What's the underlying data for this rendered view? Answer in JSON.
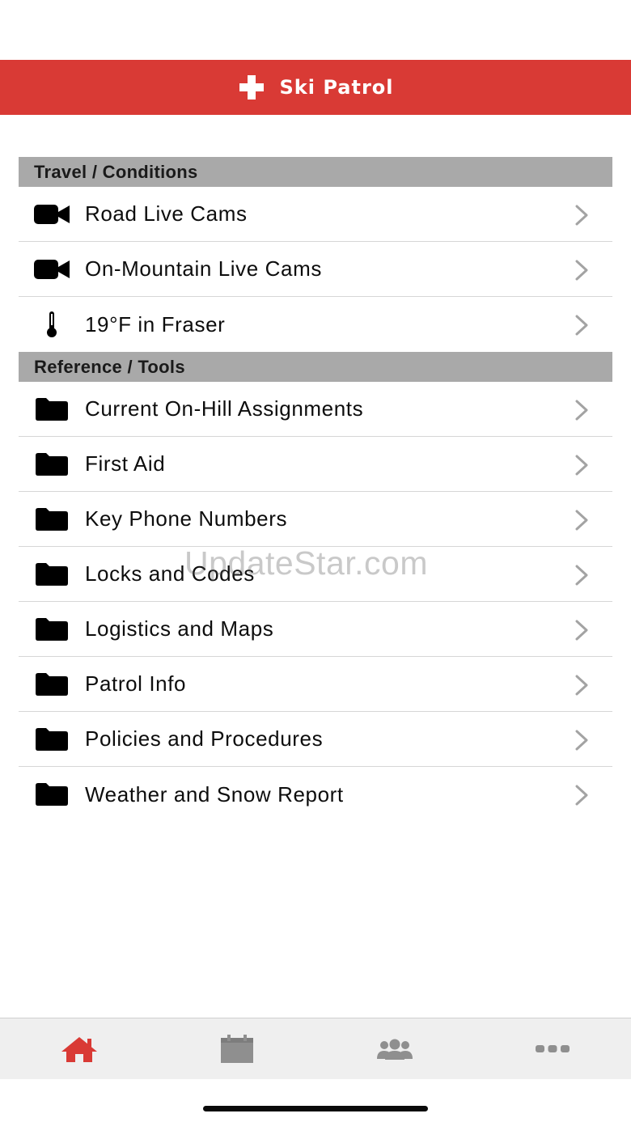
{
  "header": {
    "title": "Ski Patrol",
    "icon": "cross-icon",
    "background_color": "#d93a35"
  },
  "sections": [
    {
      "title": "Travel / Conditions",
      "items": [
        {
          "label": "Road Live Cams",
          "icon": "video-camera-icon"
        },
        {
          "label": "On-Mountain Live Cams",
          "icon": "video-camera-icon"
        },
        {
          "label": "19°F in Fraser",
          "icon": "thermometer-icon"
        }
      ]
    },
    {
      "title": "Reference / Tools",
      "items": [
        {
          "label": "Current On-Hill Assignments",
          "icon": "folder-icon"
        },
        {
          "label": "First Aid",
          "icon": "folder-icon"
        },
        {
          "label": "Key Phone Numbers",
          "icon": "folder-icon"
        },
        {
          "label": "Locks and Codes",
          "icon": "folder-icon"
        },
        {
          "label": "Logistics and Maps",
          "icon": "folder-icon"
        },
        {
          "label": "Patrol Info",
          "icon": "folder-icon"
        },
        {
          "label": "Policies and Procedures",
          "icon": "folder-icon"
        },
        {
          "label": "Weather and Snow Report",
          "icon": "folder-icon"
        }
      ]
    }
  ],
  "watermark": "UpdateStar.com",
  "tabbar": {
    "tabs": [
      {
        "icon": "home-icon",
        "selected": true
      },
      {
        "icon": "calendar-icon",
        "selected": false
      },
      {
        "icon": "people-icon",
        "selected": false
      },
      {
        "icon": "more-icon",
        "selected": false
      }
    ],
    "active_color": "#d93a35",
    "inactive_color": "#8f8f8f"
  }
}
